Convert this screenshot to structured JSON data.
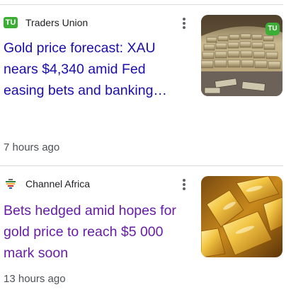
{
  "articles": [
    {
      "source": "Traders Union",
      "favicon_icon": "traders-union-logo-icon",
      "favicon_text": "TU",
      "headline": "Gold price forecast: XAU nears $4,340 amid Fed easing bets and banking…",
      "time": "7 hours ago",
      "thumbnail_badge": "TU",
      "headline_color": "#1a0dab"
    },
    {
      "source": "Channel Africa",
      "favicon_icon": "channel-africa-logo-icon",
      "headline": "Bets hedged amid hopes for gold price to reach $5 000 mark soon",
      "time": "13 hours ago",
      "headline_color": "#681da8"
    }
  ],
  "colors": {
    "brand_green": "#3cae35",
    "link_unvisited": "#1a0dab",
    "link_visited": "#681da8",
    "meta_text": "#4d5156",
    "divider": "#dadce0"
  },
  "icons": {
    "menu": "more-vertical-icon"
  }
}
